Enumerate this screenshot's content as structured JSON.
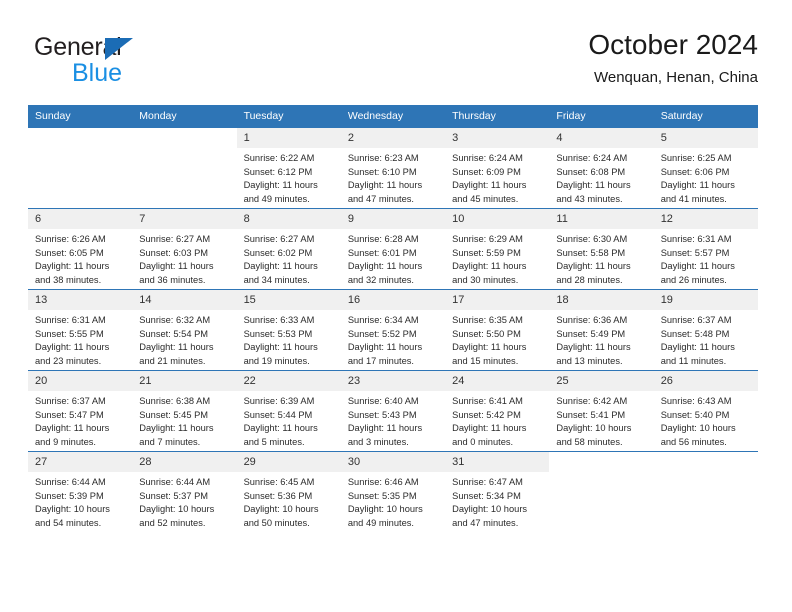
{
  "brand": {
    "name_part1": "General",
    "name_part2": "Blue",
    "logo_icon": "triangle-flag-icon",
    "accent_color": "#1b6cb5",
    "secondary_color": "#1a8fe3"
  },
  "header": {
    "title": "October 2024",
    "subtitle": "Wenquan, Henan, China"
  },
  "theme": {
    "header_blue": "#2e75b6",
    "daynum_background": "#f0f0f0"
  },
  "weekdays": [
    "Sunday",
    "Monday",
    "Tuesday",
    "Wednesday",
    "Thursday",
    "Friday",
    "Saturday"
  ],
  "weeks": [
    [
      {
        "day": "",
        "sunrise": "",
        "sunset": "",
        "daylight": "",
        "empty": true
      },
      {
        "day": "",
        "sunrise": "",
        "sunset": "",
        "daylight": "",
        "empty": true
      },
      {
        "day": "1",
        "sunrise": "Sunrise: 6:22 AM",
        "sunset": "Sunset: 6:12 PM",
        "daylight": "Daylight: 11 hours and 49 minutes."
      },
      {
        "day": "2",
        "sunrise": "Sunrise: 6:23 AM",
        "sunset": "Sunset: 6:10 PM",
        "daylight": "Daylight: 11 hours and 47 minutes."
      },
      {
        "day": "3",
        "sunrise": "Sunrise: 6:24 AM",
        "sunset": "Sunset: 6:09 PM",
        "daylight": "Daylight: 11 hours and 45 minutes."
      },
      {
        "day": "4",
        "sunrise": "Sunrise: 6:24 AM",
        "sunset": "Sunset: 6:08 PM",
        "daylight": "Daylight: 11 hours and 43 minutes."
      },
      {
        "day": "5",
        "sunrise": "Sunrise: 6:25 AM",
        "sunset": "Sunset: 6:06 PM",
        "daylight": "Daylight: 11 hours and 41 minutes."
      }
    ],
    [
      {
        "day": "6",
        "sunrise": "Sunrise: 6:26 AM",
        "sunset": "Sunset: 6:05 PM",
        "daylight": "Daylight: 11 hours and 38 minutes."
      },
      {
        "day": "7",
        "sunrise": "Sunrise: 6:27 AM",
        "sunset": "Sunset: 6:03 PM",
        "daylight": "Daylight: 11 hours and 36 minutes."
      },
      {
        "day": "8",
        "sunrise": "Sunrise: 6:27 AM",
        "sunset": "Sunset: 6:02 PM",
        "daylight": "Daylight: 11 hours and 34 minutes."
      },
      {
        "day": "9",
        "sunrise": "Sunrise: 6:28 AM",
        "sunset": "Sunset: 6:01 PM",
        "daylight": "Daylight: 11 hours and 32 minutes."
      },
      {
        "day": "10",
        "sunrise": "Sunrise: 6:29 AM",
        "sunset": "Sunset: 5:59 PM",
        "daylight": "Daylight: 11 hours and 30 minutes."
      },
      {
        "day": "11",
        "sunrise": "Sunrise: 6:30 AM",
        "sunset": "Sunset: 5:58 PM",
        "daylight": "Daylight: 11 hours and 28 minutes."
      },
      {
        "day": "12",
        "sunrise": "Sunrise: 6:31 AM",
        "sunset": "Sunset: 5:57 PM",
        "daylight": "Daylight: 11 hours and 26 minutes."
      }
    ],
    [
      {
        "day": "13",
        "sunrise": "Sunrise: 6:31 AM",
        "sunset": "Sunset: 5:55 PM",
        "daylight": "Daylight: 11 hours and 23 minutes."
      },
      {
        "day": "14",
        "sunrise": "Sunrise: 6:32 AM",
        "sunset": "Sunset: 5:54 PM",
        "daylight": "Daylight: 11 hours and 21 minutes."
      },
      {
        "day": "15",
        "sunrise": "Sunrise: 6:33 AM",
        "sunset": "Sunset: 5:53 PM",
        "daylight": "Daylight: 11 hours and 19 minutes."
      },
      {
        "day": "16",
        "sunrise": "Sunrise: 6:34 AM",
        "sunset": "Sunset: 5:52 PM",
        "daylight": "Daylight: 11 hours and 17 minutes."
      },
      {
        "day": "17",
        "sunrise": "Sunrise: 6:35 AM",
        "sunset": "Sunset: 5:50 PM",
        "daylight": "Daylight: 11 hours and 15 minutes."
      },
      {
        "day": "18",
        "sunrise": "Sunrise: 6:36 AM",
        "sunset": "Sunset: 5:49 PM",
        "daylight": "Daylight: 11 hours and 13 minutes."
      },
      {
        "day": "19",
        "sunrise": "Sunrise: 6:37 AM",
        "sunset": "Sunset: 5:48 PM",
        "daylight": "Daylight: 11 hours and 11 minutes."
      }
    ],
    [
      {
        "day": "20",
        "sunrise": "Sunrise: 6:37 AM",
        "sunset": "Sunset: 5:47 PM",
        "daylight": "Daylight: 11 hours and 9 minutes."
      },
      {
        "day": "21",
        "sunrise": "Sunrise: 6:38 AM",
        "sunset": "Sunset: 5:45 PM",
        "daylight": "Daylight: 11 hours and 7 minutes."
      },
      {
        "day": "22",
        "sunrise": "Sunrise: 6:39 AM",
        "sunset": "Sunset: 5:44 PM",
        "daylight": "Daylight: 11 hours and 5 minutes."
      },
      {
        "day": "23",
        "sunrise": "Sunrise: 6:40 AM",
        "sunset": "Sunset: 5:43 PM",
        "daylight": "Daylight: 11 hours and 3 minutes."
      },
      {
        "day": "24",
        "sunrise": "Sunrise: 6:41 AM",
        "sunset": "Sunset: 5:42 PM",
        "daylight": "Daylight: 11 hours and 0 minutes."
      },
      {
        "day": "25",
        "sunrise": "Sunrise: 6:42 AM",
        "sunset": "Sunset: 5:41 PM",
        "daylight": "Daylight: 10 hours and 58 minutes."
      },
      {
        "day": "26",
        "sunrise": "Sunrise: 6:43 AM",
        "sunset": "Sunset: 5:40 PM",
        "daylight": "Daylight: 10 hours and 56 minutes."
      }
    ],
    [
      {
        "day": "27",
        "sunrise": "Sunrise: 6:44 AM",
        "sunset": "Sunset: 5:39 PM",
        "daylight": "Daylight: 10 hours and 54 minutes."
      },
      {
        "day": "28",
        "sunrise": "Sunrise: 6:44 AM",
        "sunset": "Sunset: 5:37 PM",
        "daylight": "Daylight: 10 hours and 52 minutes."
      },
      {
        "day": "29",
        "sunrise": "Sunrise: 6:45 AM",
        "sunset": "Sunset: 5:36 PM",
        "daylight": "Daylight: 10 hours and 50 minutes."
      },
      {
        "day": "30",
        "sunrise": "Sunrise: 6:46 AM",
        "sunset": "Sunset: 5:35 PM",
        "daylight": "Daylight: 10 hours and 49 minutes."
      },
      {
        "day": "31",
        "sunrise": "Sunrise: 6:47 AM",
        "sunset": "Sunset: 5:34 PM",
        "daylight": "Daylight: 10 hours and 47 minutes."
      },
      {
        "day": "",
        "sunrise": "",
        "sunset": "",
        "daylight": "",
        "empty": true
      },
      {
        "day": "",
        "sunrise": "",
        "sunset": "",
        "daylight": "",
        "empty": true
      }
    ]
  ]
}
